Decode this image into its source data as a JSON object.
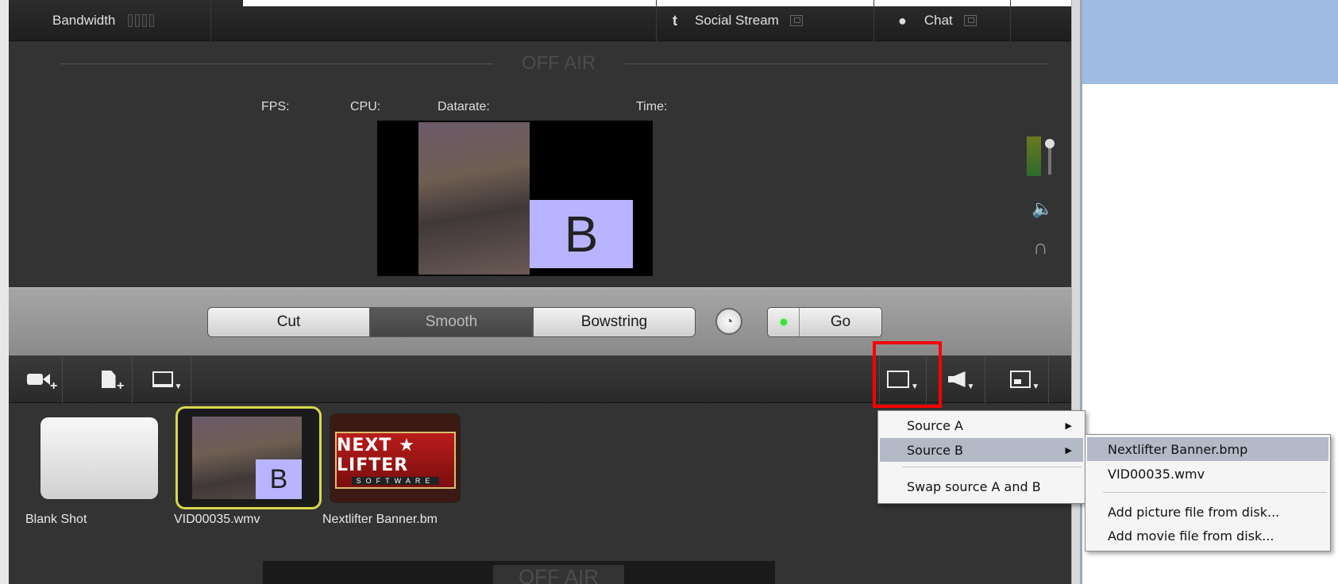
{
  "topbar": {
    "bandwidth_label": "Bandwidth",
    "social_stream_label": "Social Stream",
    "chat_label": "Chat"
  },
  "preview": {
    "status": "OFF AIR",
    "stats": {
      "fps": "FPS:",
      "cpu": "CPU:",
      "datarate": "Datarate:",
      "time": "Time:"
    },
    "overlay_letter": "B"
  },
  "transitions": {
    "options": [
      "Cut",
      "Smooth",
      "Bowstring"
    ],
    "selected": "Smooth",
    "go_label": "Go"
  },
  "shots": [
    {
      "label": "Blank Shot"
    },
    {
      "label": "VID00035.wmv",
      "overlay_letter": "B",
      "selected": true
    },
    {
      "label": "Nextlifter Banner.bm",
      "banner_title": "NEXT ★ LIFTER",
      "banner_sub": "SOFTWARE"
    }
  ],
  "bottom": {
    "status": "OFF AIR"
  },
  "menu_layer": {
    "items": [
      "Source A",
      "Source B",
      "Swap source A and B"
    ],
    "highlighted": "Source B"
  },
  "menu_source_b": {
    "items": [
      "Nextlifter Banner.bmp",
      "VID00035.wmv",
      "Add picture file from disk...",
      "Add movie file from disk..."
    ],
    "highlighted": "Nextlifter Banner.bmp"
  },
  "colors": {
    "accent_selection": "#d8d84a",
    "highlight_box": "#ff0000",
    "overlay": "#b8b4ff",
    "go_led": "#35e235"
  }
}
